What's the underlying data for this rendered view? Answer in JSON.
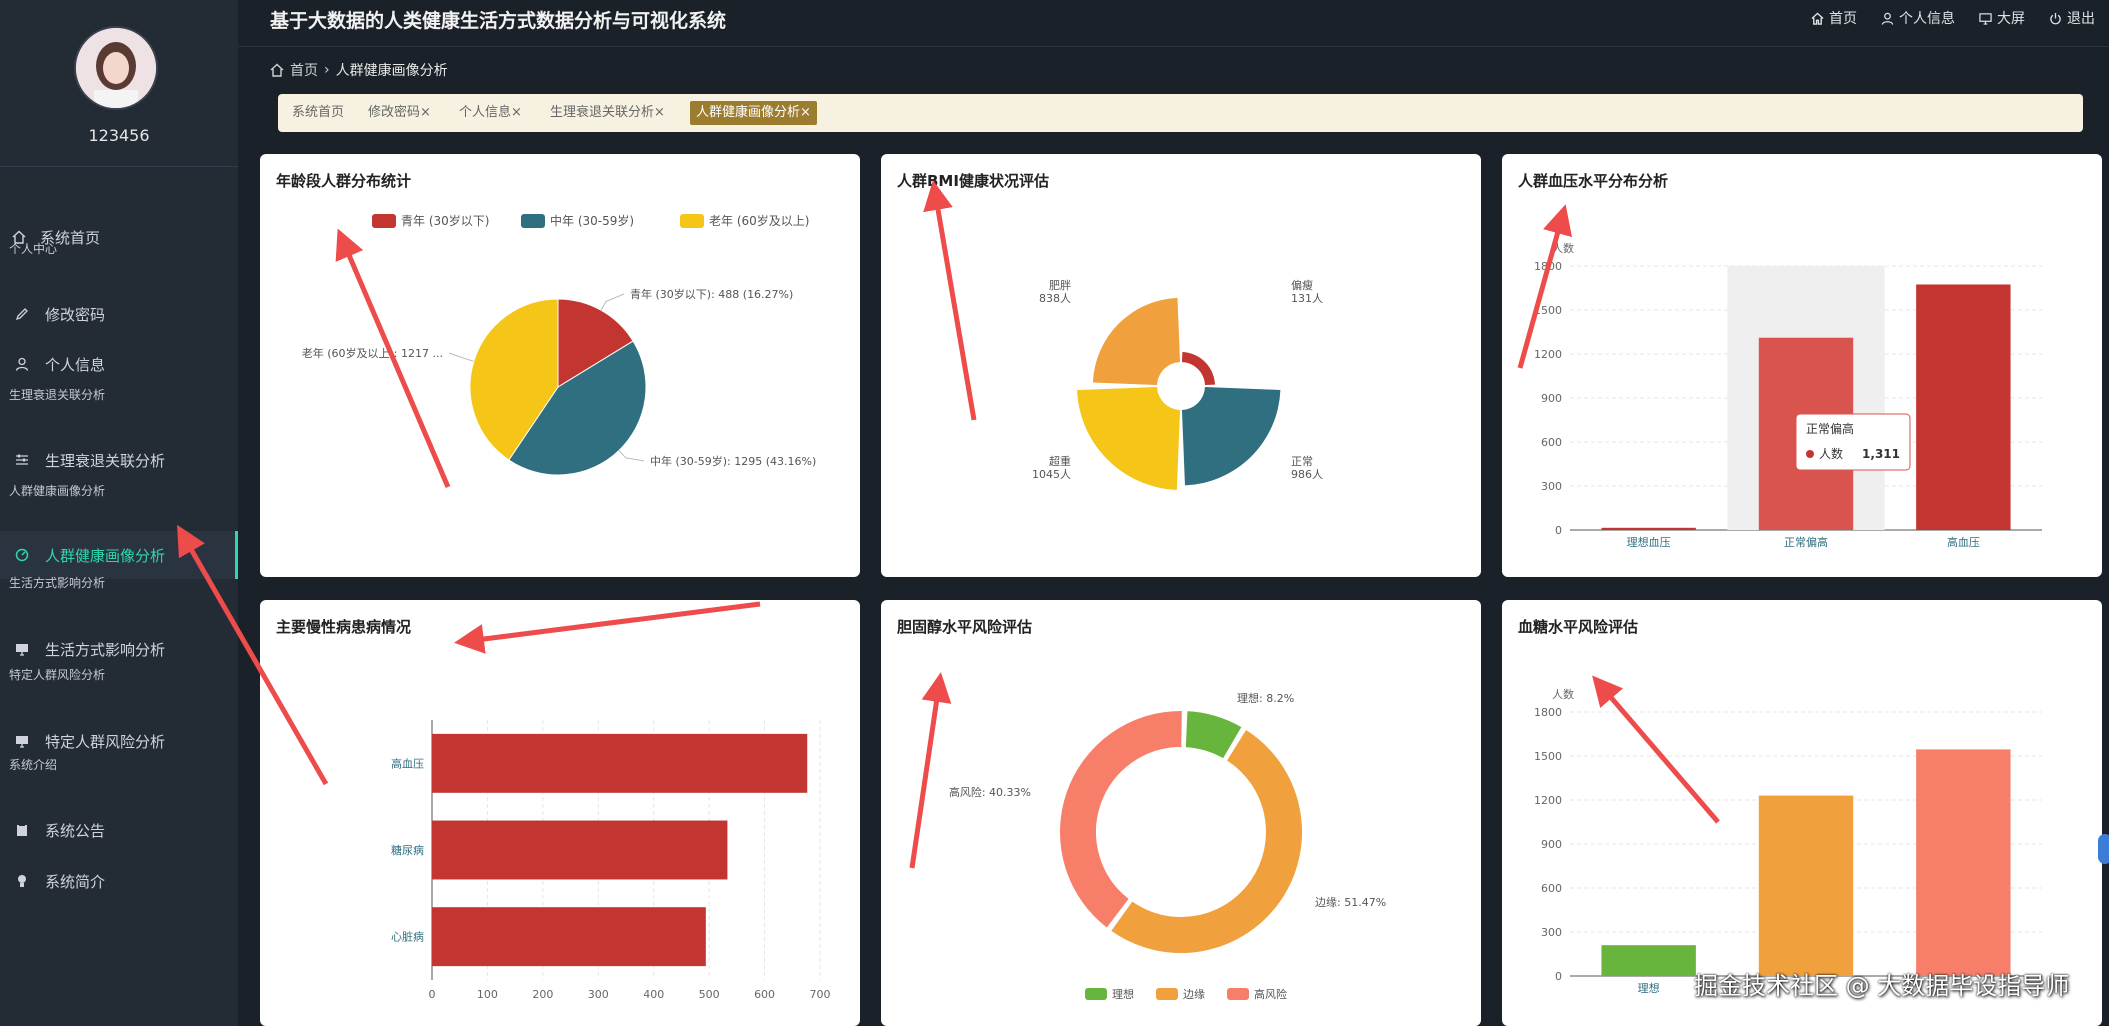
{
  "app": {
    "title": "基于大数据的人类健康生活方式数据分析与可视化系统"
  },
  "top_nav": [
    {
      "label": "首页",
      "icon": "home-icon"
    },
    {
      "label": "个人信息",
      "icon": "user-icon"
    },
    {
      "label": "大屏",
      "icon": "monitor-icon"
    },
    {
      "label": "退出",
      "icon": "power-icon"
    }
  ],
  "user": {
    "name": "123456"
  },
  "sidebar": {
    "items": [
      {
        "label": "系统首页"
      },
      {
        "group": "个人中心"
      },
      {
        "label": "修改密码"
      },
      {
        "label": "个人信息"
      },
      {
        "group": "生理衰退关联分析"
      },
      {
        "label": "生理衰退关联分析"
      },
      {
        "group": "人群健康画像分析"
      },
      {
        "label": "人群健康画像分析",
        "active": true
      },
      {
        "group": "生活方式影响分析"
      },
      {
        "label": "生活方式影响分析"
      },
      {
        "group": "特定人群风险分析"
      },
      {
        "label": "特定人群风险分析"
      },
      {
        "group": "系统介绍"
      },
      {
        "label": "系统公告"
      },
      {
        "label": "系统简介"
      }
    ]
  },
  "breadcrumb": {
    "home": "首页",
    "current": "人群健康画像分析"
  },
  "tabs": [
    {
      "label": "系统首页",
      "closable": false
    },
    {
      "label": "修改密码",
      "closable": true
    },
    {
      "label": "个人信息",
      "closable": true
    },
    {
      "label": "生理衰退关联分析",
      "closable": true
    },
    {
      "label": "人群健康画像分析",
      "closable": true,
      "active": true
    }
  ],
  "tab_close_glyph": "×",
  "colors": {
    "accent": "#2fd6b0",
    "red": "#c23531",
    "teal": "#2f6f7f",
    "yellow": "#f5c518",
    "orange": "#f0a03c",
    "green": "#67b53d",
    "salmon": "#f77f6a"
  },
  "charts": {
    "age": {
      "title": "年龄段人群分布统计"
    },
    "bmi": {
      "title": "人群BMI健康状况评估"
    },
    "bp": {
      "title": "人群血压水平分布分析",
      "tooltip": {
        "title": "正常偏高",
        "series": "人数",
        "value": "1,311"
      }
    },
    "chronic": {
      "title": "主要慢性病患病情况"
    },
    "chol": {
      "title": "胆固醇水平风险评估"
    },
    "sugar": {
      "title": "血糖水平风险评估"
    }
  },
  "chart_data": [
    {
      "id": "age",
      "type": "pie",
      "title": "年龄段人群分布统计",
      "legend": [
        "青年 (30岁以下)",
        "中年 (30-59岁)",
        "老年 (60岁及以上)"
      ],
      "slices": [
        {
          "name": "青年 (30岁以下)",
          "value": 488,
          "label": "青年 (30岁以下): 488 (16.27%)"
        },
        {
          "name": "中年 (30-59岁)",
          "value": 1295,
          "label": "中年 (30-59岁): 1295 (43.16%)"
        },
        {
          "name": "老年 (60岁及以上)",
          "value": 1217,
          "label": "老年 (60岁及以上): 1217 ..."
        }
      ]
    },
    {
      "id": "bmi",
      "type": "pie",
      "title": "人群BMI健康状况评估",
      "rose": true,
      "slices": [
        {
          "name": "偏瘦",
          "value": 131,
          "label": "131人"
        },
        {
          "name": "正常",
          "value": 986,
          "label": "986人"
        },
        {
          "name": "超重",
          "value": 1045,
          "label": "1045人"
        },
        {
          "name": "肥胖",
          "value": 838,
          "label": "838人"
        }
      ]
    },
    {
      "id": "bp",
      "type": "bar",
      "title": "人群血压水平分布分析",
      "ylabel": "人数",
      "categories": [
        "理想血压",
        "正常偏高",
        "高血压"
      ],
      "values": [
        15,
        1311,
        1674
      ],
      "ylim": [
        0,
        1800
      ],
      "yticks": [
        0,
        300,
        600,
        900,
        1200,
        1500,
        1800
      ]
    },
    {
      "id": "chronic",
      "type": "bar",
      "orientation": "horizontal",
      "title": "主要慢性病患病情况",
      "categories": [
        "高血压",
        "糖尿病",
        "心脏病"
      ],
      "values": [
        677,
        533,
        494
      ],
      "xlim": [
        0,
        700
      ],
      "xticks": [
        0,
        100,
        200,
        300,
        400,
        500,
        600,
        700
      ]
    },
    {
      "id": "chol",
      "type": "pie",
      "donut": true,
      "title": "胆固醇水平风险评估",
      "legend": [
        "理想",
        "边缘",
        "高风险"
      ],
      "slices": [
        {
          "name": "理想",
          "percent": 8.2,
          "label": "理想: 8.2%"
        },
        {
          "name": "边缘",
          "percent": 51.47,
          "label": "边缘: 51.47%"
        },
        {
          "name": "高风险",
          "percent": 40.33,
          "label": "高风险: 40.33%"
        }
      ]
    },
    {
      "id": "sugar",
      "type": "bar",
      "title": "血糖水平风险评估",
      "ylabel": "人数",
      "categories": [
        "理想"
      ],
      "values": [
        210,
        1230,
        1545
      ],
      "ylim": [
        0,
        1800
      ],
      "yticks": [
        0,
        300,
        600,
        900,
        1200,
        1500,
        1800
      ]
    }
  ],
  "watermark": "掘金技术社区 @ 大数据毕设指导师"
}
